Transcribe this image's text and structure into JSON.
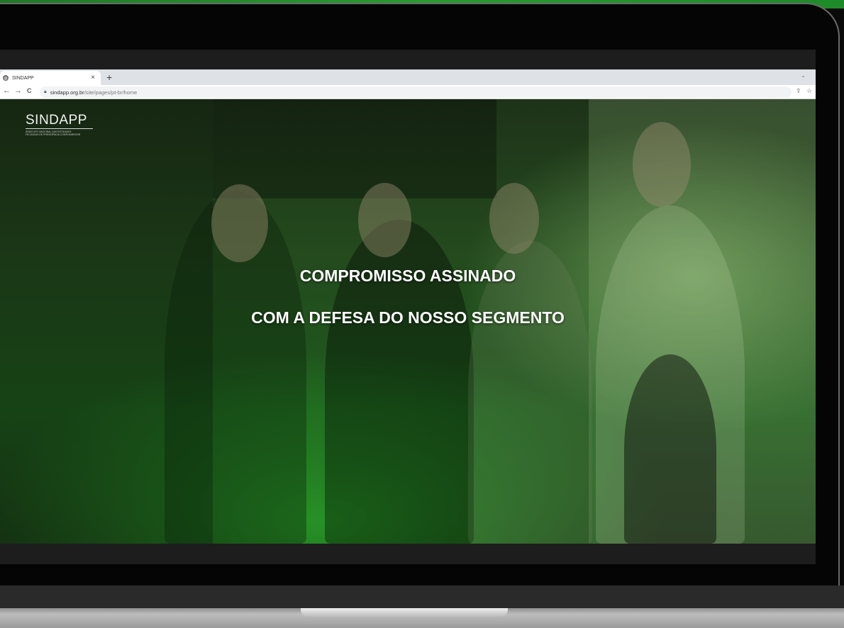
{
  "browser": {
    "tab_title": "SINDAPP",
    "tab_close": "×",
    "new_tab": "+",
    "tab_menu": "⌄",
    "back": "←",
    "forward": "→",
    "reload": "C",
    "url_domain": "sindapp.org.br",
    "url_path": "/site/pages/pt-br/home",
    "share_icon": "⇪",
    "bookmark_icon": "☆"
  },
  "logo": {
    "wordmark": "SINDAPP",
    "tagline_line1": "SINDICATO NACIONAL DAS ENTIDADES",
    "tagline_line2": "FECHADAS DE PREVIDÊNCIA COMPLEMENTAR"
  },
  "hero": {
    "headline_line1": "COMPROMISSO ASSINADO",
    "headline_line2": "COM A DEFESA DO NOSSO SEGMENTO"
  },
  "colors": {
    "brand_green": "#2a9a30",
    "headline_text": "#ffffff"
  }
}
